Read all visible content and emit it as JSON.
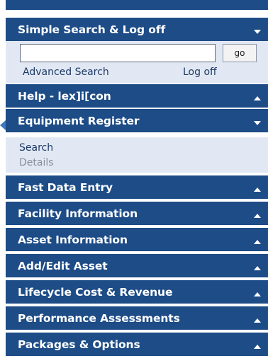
{
  "panel_header": {
    "label": "Simple Search & Log off",
    "state": "expanded",
    "icon": "chevron-down-icon"
  },
  "search": {
    "value": "",
    "placeholder": "",
    "go_label": "go",
    "advanced_label": "Advanced Search",
    "logoff_label": "Log off"
  },
  "sections": [
    {
      "label": "Help - lex]i[con",
      "state": "collapsed",
      "icon": "chevron-up-icon"
    },
    {
      "label": "Equipment Register",
      "state": "expanded",
      "icon": "chevron-down-icon",
      "items": [
        {
          "label": "Search",
          "enabled": true
        },
        {
          "label": "Details",
          "enabled": false
        }
      ]
    },
    {
      "label": "Fast Data Entry",
      "state": "collapsed",
      "icon": "chevron-up-icon"
    },
    {
      "label": "Facility Information",
      "state": "collapsed",
      "icon": "chevron-up-icon"
    },
    {
      "label": "Asset Information",
      "state": "collapsed",
      "icon": "chevron-up-icon"
    },
    {
      "label": "Add/Edit Asset",
      "state": "collapsed",
      "icon": "chevron-up-icon"
    },
    {
      "label": "Lifecycle Cost & Revenue",
      "state": "collapsed",
      "icon": "chevron-up-icon"
    },
    {
      "label": "Performance Assessments",
      "state": "collapsed",
      "icon": "chevron-up-icon"
    },
    {
      "label": "Packages & Options",
      "state": "collapsed",
      "icon": "chevron-up-icon"
    }
  ],
  "colors": {
    "header_bg": "#1d4c87",
    "header_text": "#ffffff",
    "subpanel_bg": "#e2e8f3",
    "link_text": "#1d3a66",
    "disabled_text": "#8a8f98"
  }
}
